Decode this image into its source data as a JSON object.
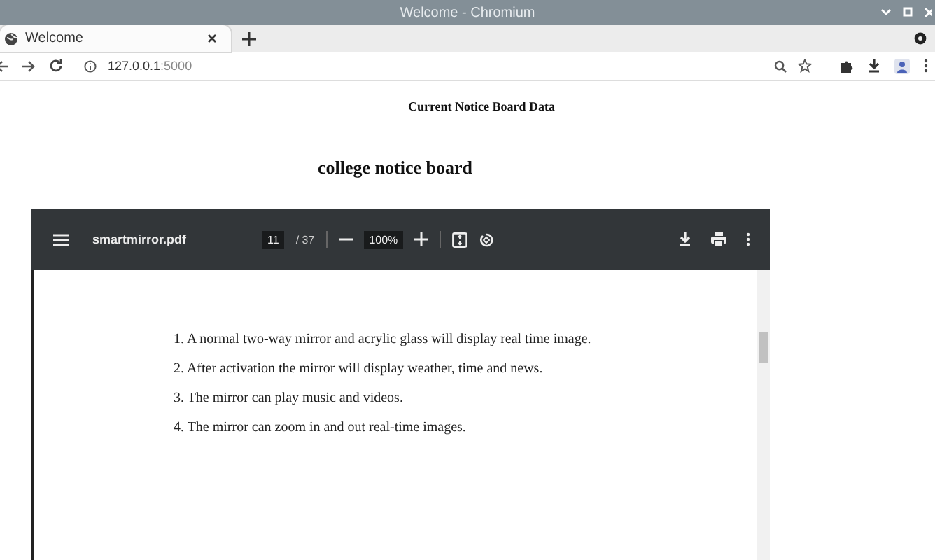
{
  "window": {
    "title": "Welcome - Chromium"
  },
  "tabs": [
    {
      "label": "Welcome",
      "selected": true
    }
  ],
  "address_bar": {
    "host": "127.0.0.1",
    "port": ":5000"
  },
  "page": {
    "heading": "Current Notice Board Data",
    "subheading": "college notice board"
  },
  "pdf_viewer": {
    "file_name": "smartmirror.pdf",
    "page_number": "11",
    "page_total": "/ 37",
    "zoom": "100%",
    "lines": [
      "1. A normal two-way mirror and acrylic glass will display real time image.",
      "2. After activation the mirror will display weather, time and news.",
      "3. The mirror can play music and videos.",
      "4. The mirror can zoom in and out real-time images."
    ]
  }
}
